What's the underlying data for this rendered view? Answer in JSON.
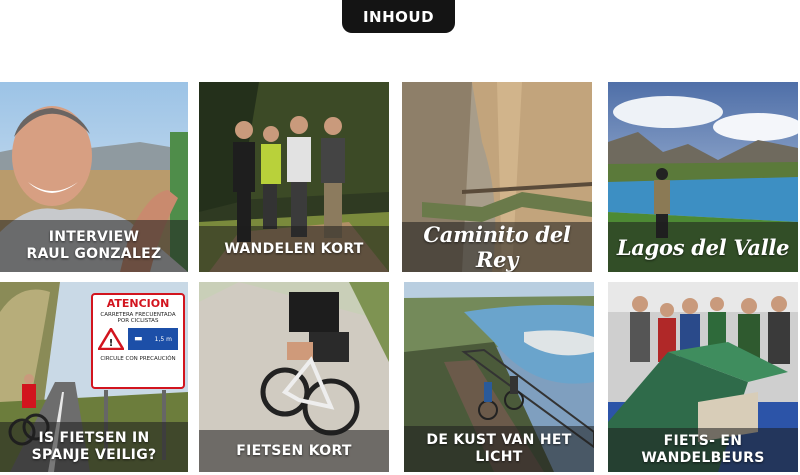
{
  "header": {
    "tab_label": "INHOUD"
  },
  "tiles": [
    {
      "line1": "INTERVIEW",
      "line2": "RAUL GONZALEZ"
    },
    {
      "title": "WANDELEN KORT"
    },
    {
      "title": "Caminito del Rey"
    },
    {
      "title": "Lagos del Valle"
    },
    {
      "line1": "IS FIETSEN IN",
      "line2": "SPANJE VEILIG?"
    },
    {
      "title": "FIETSEN KORT"
    },
    {
      "title": "DE KUST VAN HET LICHT"
    },
    {
      "title": "FIETS- EN WANDELBEURS"
    }
  ],
  "road_sign": {
    "heading": "ATENCION",
    "line1": "CARRETERA FRECUENTADA",
    "line2": "POR CICLISTAS",
    "distance": "1,5 m",
    "footer": "CIRCULE CON PRECAUCIÓN"
  },
  "colors": {
    "tab_bg": "#141414",
    "caption_band": "rgba(30,30,30,0.55)",
    "sign_red": "#d2141e",
    "sign_blue": "#1c4fa8"
  }
}
